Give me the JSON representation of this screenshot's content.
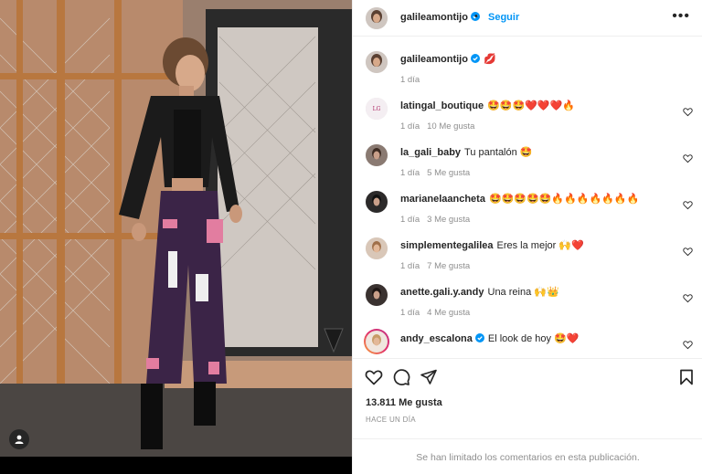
{
  "post": {
    "author": "galileamontijo",
    "follow_label": "Seguir",
    "separator": "•",
    "more_label": "•••"
  },
  "caption": {
    "username": "galileamontijo",
    "text": "💋",
    "time": "1 día"
  },
  "comments": [
    {
      "username": "latingal_boutique",
      "text": "🤩🤩🤩❤️❤️❤️🔥",
      "time": "1 día",
      "likes": "10 Me gusta"
    },
    {
      "username": "la_gali_baby",
      "text": "Tu pantalón 🤩",
      "time": "1 día",
      "likes": "5 Me gusta"
    },
    {
      "username": "marianelaancheta",
      "text": "🤩🤩🤩🤩🤩🔥🔥🔥🔥🔥🔥🔥",
      "time": "1 día",
      "likes": "3 Me gusta"
    },
    {
      "username": "simplementegalilea",
      "text": "Eres la mejor 🙌❤️",
      "time": "1 día",
      "likes": "7 Me gusta"
    },
    {
      "username": "anette.gali.y.andy",
      "text": "Una reina 🙌👑",
      "time": "1 día",
      "likes": "4 Me gusta"
    },
    {
      "username": "andy_escalona",
      "text": "El look de hoy 🤩❤️",
      "time": "",
      "likes": ""
    }
  ],
  "likes_count": "13.811 Me gusta",
  "time_ago": "HACE UN DÍA",
  "comments_limited": "Se han limitado los comentarios en esta publicación.",
  "colors": {
    "accent": "#0095f6",
    "muted": "#8e8e8e",
    "text": "#262626"
  }
}
